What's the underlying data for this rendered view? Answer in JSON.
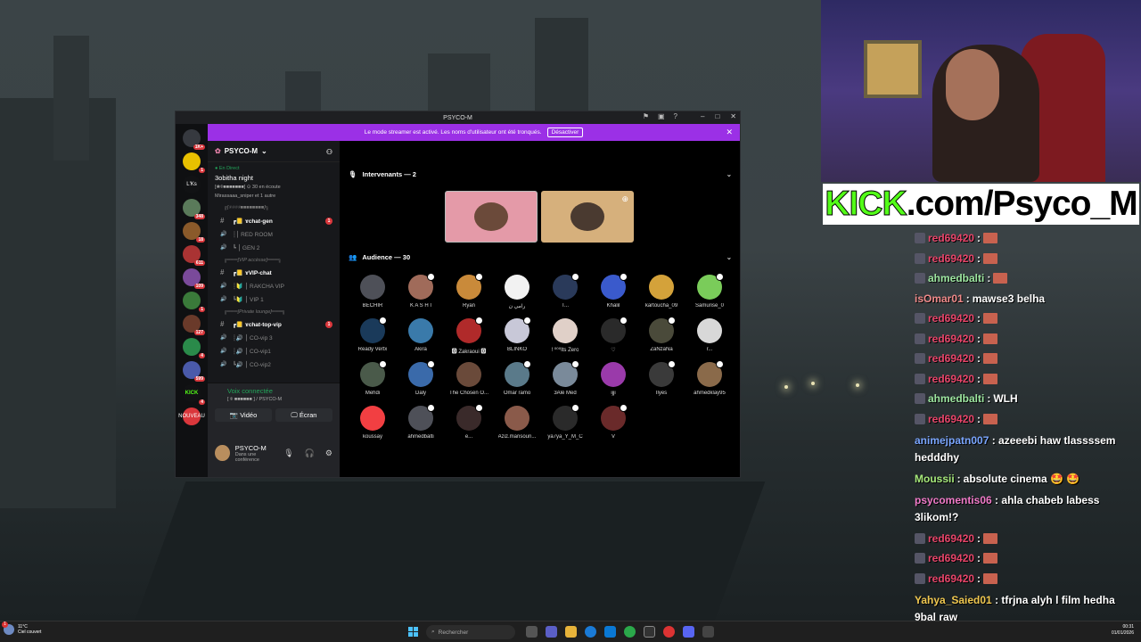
{
  "window": {
    "title": "PSYCO-M"
  },
  "servers": [
    {
      "badge": "1K+",
      "color": "#36393f"
    },
    {
      "badge": "1",
      "color": "#e8c000"
    },
    {
      "label": "L'Ks",
      "color": "#111214"
    },
    {
      "badge": "348",
      "color": "#5a7a5a"
    },
    {
      "badge": "18",
      "color": "#8a5a2a"
    },
    {
      "badge": "611",
      "color": "#aa3333"
    },
    {
      "badge": "109",
      "color": "#7a4a9a"
    },
    {
      "badge": "1",
      "color": "#3a7a3a"
    },
    {
      "badge": "127",
      "color": "#6a3a2a"
    },
    {
      "badge": "4",
      "color": "#2a8a4a"
    },
    {
      "badge": "599",
      "color": "#4a5aaa"
    },
    {
      "label": "KICK",
      "badge": "4",
      "color": "#111214"
    },
    {
      "label": "NOUVEAU",
      "color": "#da373c"
    }
  ],
  "banner": {
    "text": "Le mode streamer est activé. Les noms d'utilisateur ont été tronqués.",
    "button": "Désactiver"
  },
  "sidebar": {
    "server_name": "PSYCO-M",
    "live": {
      "tag": "En Direct",
      "event": "3obitha night",
      "info": "[❀⍟■■■■■■■]   ⊙ 30 en écoute",
      "sub": "Mirassaaa_sniper et 1 autre"
    },
    "channels": [
      {
        "type": "cat",
        "label": "╔[⍟⍟⍟⍟■■■■■■■■]╗"
      },
      {
        "type": "text",
        "label": "┏📒 ɤchat-gen",
        "strong": true,
        "badge": "1"
      },
      {
        "type": "voice",
        "label": "┊⎮ RED ROOM"
      },
      {
        "type": "voice",
        "label": "┗ ⎮ GEN 2"
      },
      {
        "type": "cat",
        "label": "╔═══[VIP accèsse]═══╗"
      },
      {
        "type": "text",
        "label": "┏📒 ɤVIP-chat",
        "strong": true
      },
      {
        "type": "voice",
        "label": "┊🔰 ⎮ RAKCHA VIP"
      },
      {
        "type": "voice",
        "label": "┗🔰 ⎮ VIP 1"
      },
      {
        "type": "cat",
        "label": "╔═══[Private lounge]═══╗"
      },
      {
        "type": "text",
        "label": "┏📒 ɤchat-top-vip",
        "strong": true,
        "badge": "1"
      },
      {
        "type": "voice",
        "label": "┊🔊 ⎮ CO-vip 3"
      },
      {
        "type": "voice",
        "label": "┊🔊 ⎮ CO-vip1"
      },
      {
        "type": "voice",
        "label": "┗🔊 ⎮ CO-vip2"
      }
    ],
    "voice": {
      "status": "Voix connectée",
      "channel": "[ ⍟ ■■■■■■ ] / PSYCO-M",
      "video": "Vidéo",
      "screen": "Écran"
    },
    "user": {
      "name": "PSYCO-M",
      "status": "Dans une conférence"
    }
  },
  "stage": {
    "speakers_header": "Intervenants — 2",
    "audience_header": "Audience — 30",
    "members": [
      {
        "name": "BECHIR",
        "color": "#4e5058"
      },
      {
        "name": "K A S H I",
        "color": "#a06b5a"
      },
      {
        "name": "Ryan",
        "color": "#c98a3a"
      },
      {
        "name": "رامي ن",
        "color": "#f2f2f2"
      },
      {
        "name": "T...",
        "color": "#2a3a5a"
      },
      {
        "name": "Khalil",
        "color": "#3a5acc"
      },
      {
        "name": "kartoucha_09",
        "color": "#d4a23a"
      },
      {
        "name": "Samurise_0",
        "color": "#7acc5a"
      },
      {
        "name": "Ready Vertx",
        "color": "#1a3a5a"
      },
      {
        "name": "Akira",
        "color": "#3a7aaa"
      },
      {
        "name": "🅾 Zakraoui 🅾",
        "color": "#b02a2a"
      },
      {
        "name": "BLINKO",
        "color": "#c8c8d8"
      },
      {
        "name": "! ⁰⁰⁰Its Zero",
        "color": "#e0d0c8"
      },
      {
        "name": "♡",
        "color": "#2a2a2a"
      },
      {
        "name": "ZaNzaNa",
        "color": "#4a4a3a"
      },
      {
        "name": "r...",
        "color": "#d8d8d8"
      },
      {
        "name": "Mehdi",
        "color": "#4a5a4a"
      },
      {
        "name": "Daly",
        "color": "#3a6aaa"
      },
      {
        "name": "The Chosen O...",
        "color": "#6a4a3a"
      },
      {
        "name": "Omar ramo",
        "color": "#5a7a8a"
      },
      {
        "name": "3Alé Med",
        "color": "#7a8a9a"
      },
      {
        "name": "ijji",
        "color": "#9a3aaa"
      },
      {
        "name": "Ilyes",
        "color": "#3a3a3a"
      },
      {
        "name": "ahmedklay95",
        "color": "#8a6a4a"
      },
      {
        "name": "koussay",
        "color": "#f23f42"
      },
      {
        "name": "ahmedbalti",
        "color": "#4e5058"
      },
      {
        "name": "e...",
        "color": "#3a2a2a"
      },
      {
        "name": "Aziz.mansouri...",
        "color": "#8a5a4a"
      },
      {
        "name": "ya7ya_Y_M_C",
        "color": "#2a2a2a"
      },
      {
        "name": "V",
        "color": "#6a2a2a"
      }
    ]
  },
  "overlay": {
    "kick_prefix": "KICK",
    "kick_suffix": ".com/Psyco_M"
  },
  "chat": [
    {
      "user": "red69420",
      "color": "#e8456a",
      "text": "",
      "emote": true
    },
    {
      "user": "red69420",
      "color": "#e8456a",
      "text": "",
      "emote": true
    },
    {
      "user": "ahmedbalti",
      "color": "#9de6a0",
      "text": "",
      "emote": true
    },
    {
      "user": "isOmar01",
      "color": "#f08a8a",
      "text": "mawse3 belha",
      "noicon": true
    },
    {
      "user": "red69420",
      "color": "#e8456a",
      "text": "",
      "emote": true
    },
    {
      "user": "red69420",
      "color": "#e8456a",
      "text": "",
      "emote": true
    },
    {
      "user": "red69420",
      "color": "#e8456a",
      "text": "",
      "emote": true
    },
    {
      "user": "red69420",
      "color": "#e8456a",
      "text": "",
      "emote": true
    },
    {
      "user": "ahmedbalti",
      "color": "#9de6a0",
      "text": "WLH"
    },
    {
      "user": "red69420",
      "color": "#e8456a",
      "text": "",
      "emote": true
    },
    {
      "user": "animejpatn007",
      "color": "#7aa6ff",
      "text": "azeeebi haw tlassssem hedddhy",
      "noicon": true,
      "multiline": true
    },
    {
      "user": "Moussii",
      "color": "#a6e87a",
      "text": "absolute cinema 🤩 🤩",
      "noicon": true
    },
    {
      "user": "psycomentis06",
      "color": "#f07ac8",
      "text": "ahla chabeb labess 3likom!?",
      "noicon": true,
      "multiline": true
    },
    {
      "user": "red69420",
      "color": "#e8456a",
      "text": "",
      "emote": true
    },
    {
      "user": "red69420",
      "color": "#e8456a",
      "text": "",
      "emote": true
    },
    {
      "user": "red69420",
      "color": "#e8456a",
      "text": "",
      "emote": true
    },
    {
      "user": "Yahya_Saied01",
      "color": "#f0c850",
      "text": "tfrjna alyh l film hedha 9bal raw",
      "noicon": true,
      "multiline": true
    },
    {
      "user": "red69420",
      "color": "#e8456a",
      "text": "",
      "emote": true
    }
  ],
  "taskbar": {
    "weather_temp": "11°C",
    "weather_desc": "Ciel couvert",
    "search_placeholder": "Rechercher",
    "time": "00:31",
    "date": "01/01/2026"
  }
}
